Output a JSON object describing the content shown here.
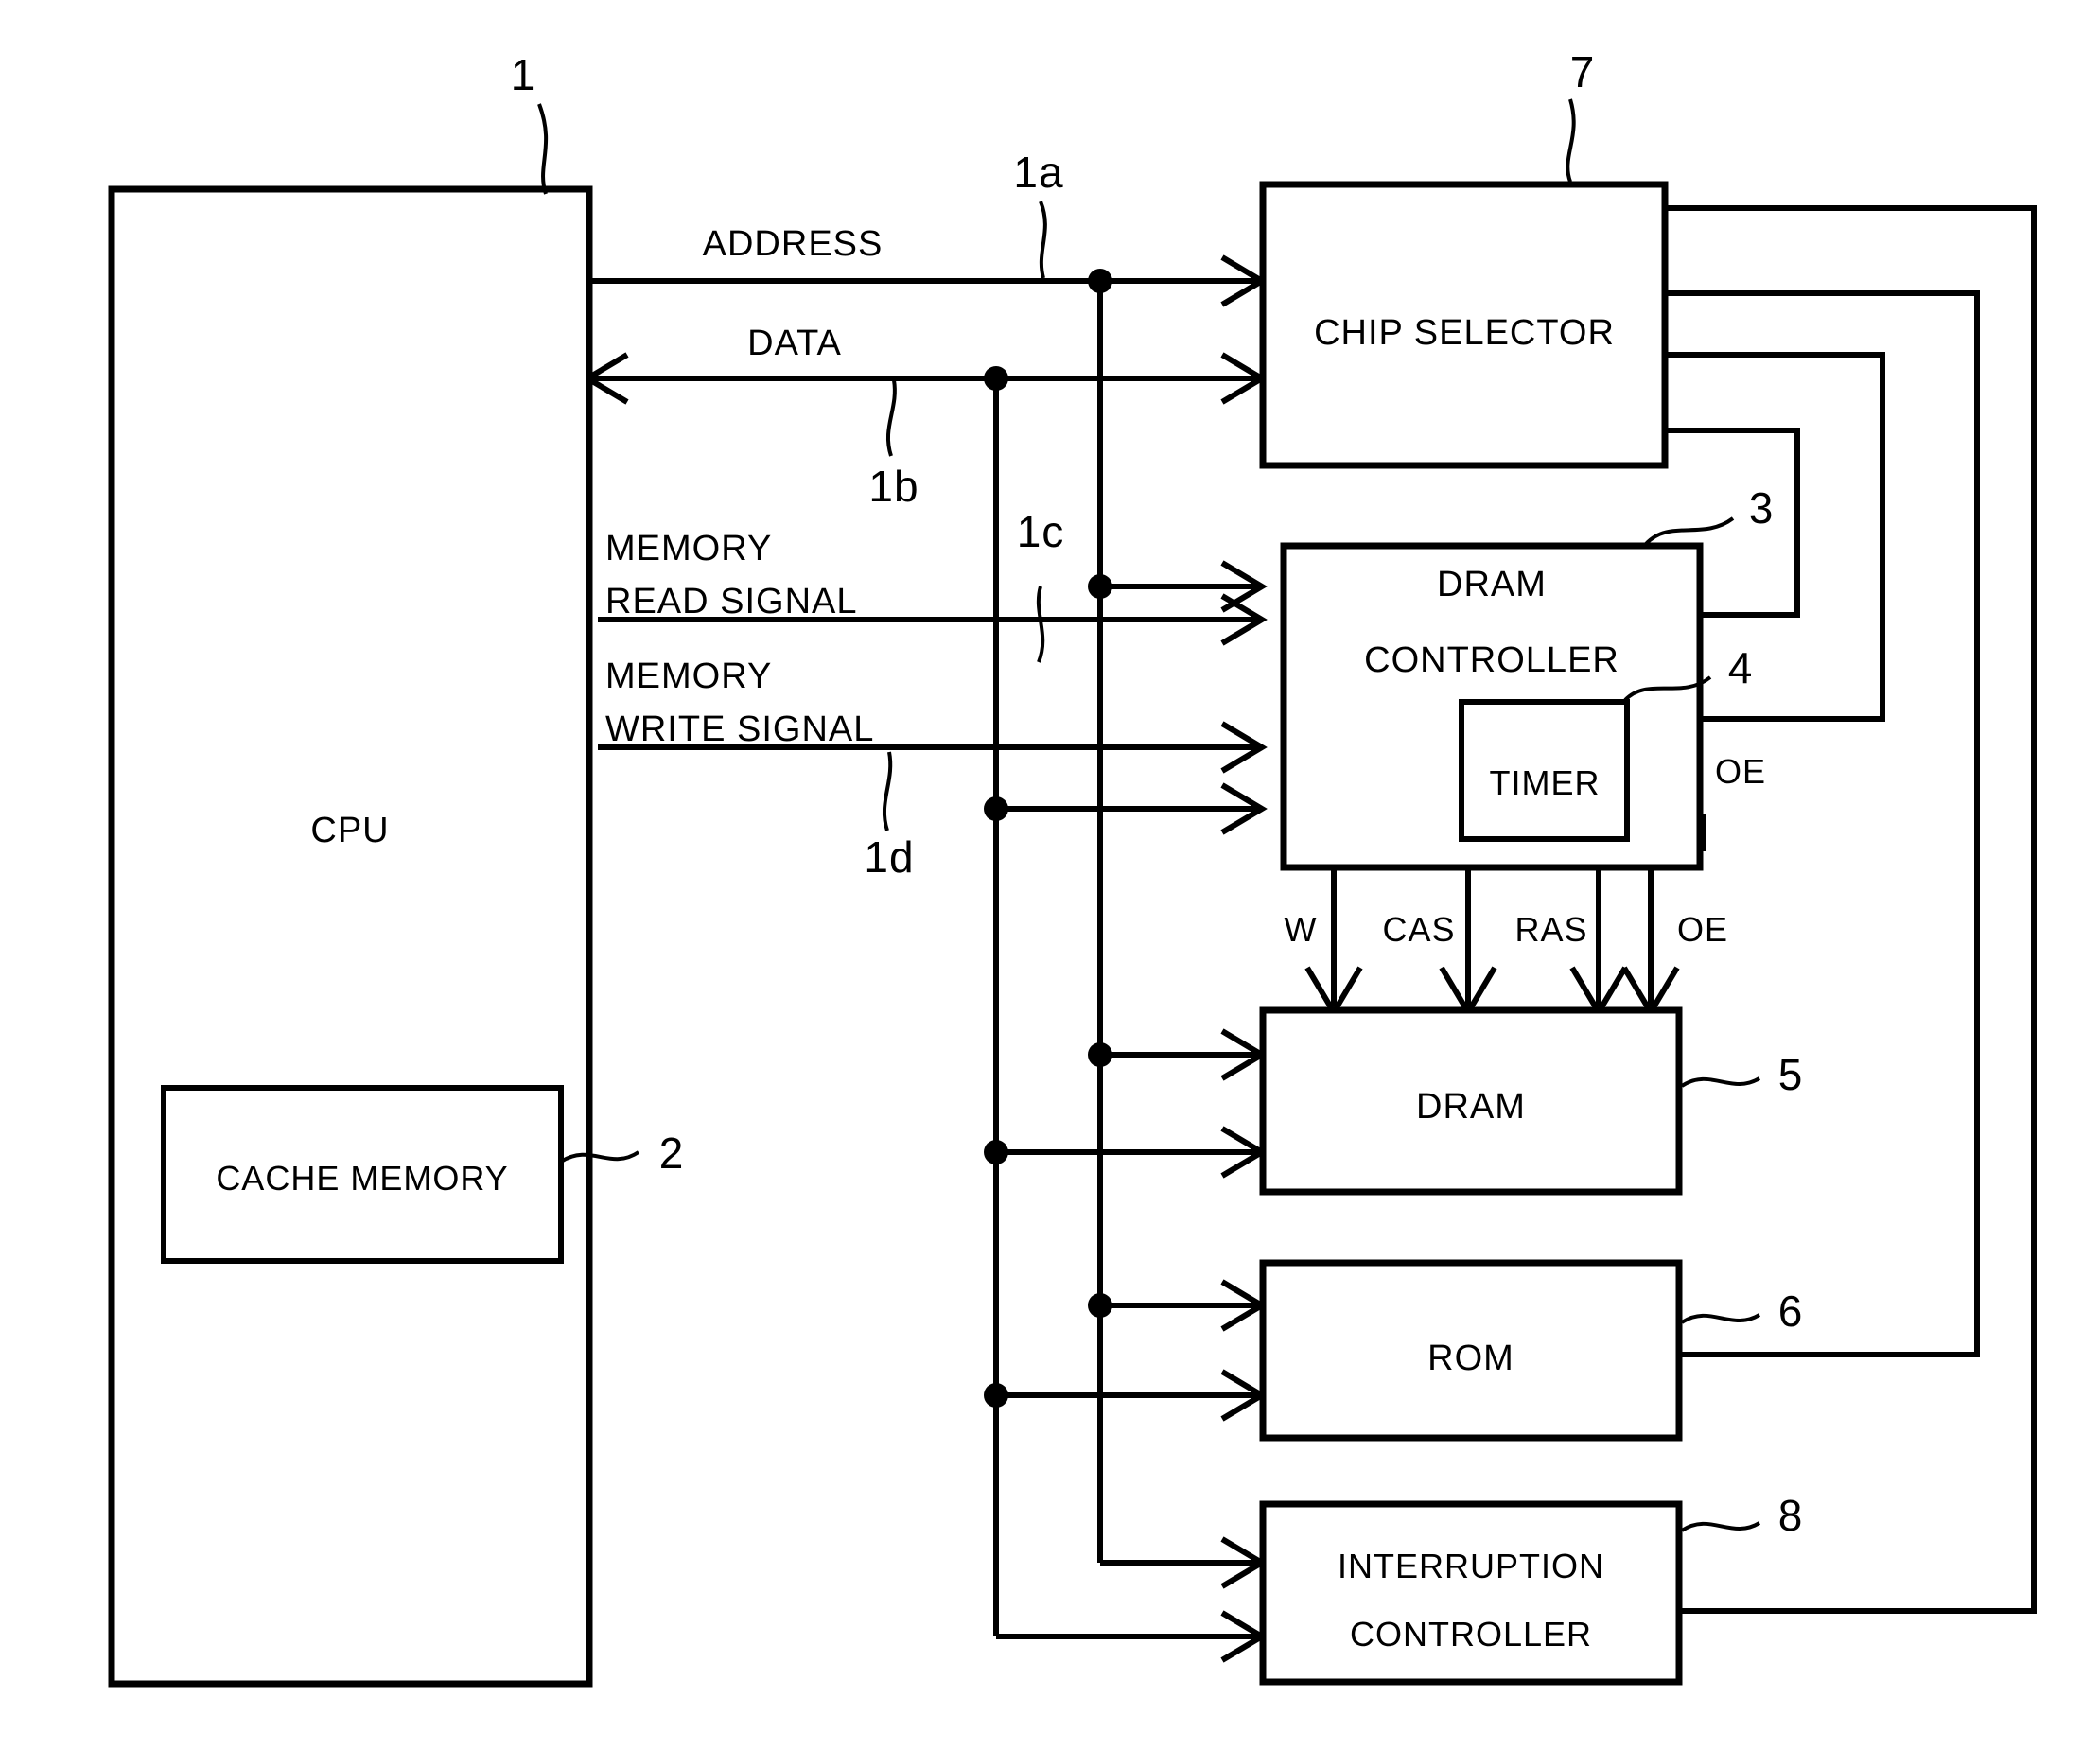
{
  "figure": {
    "type": "block-diagram",
    "background": "#ffffff",
    "line_color": "#000000"
  },
  "blocks": {
    "cpu": {
      "label": "CPU",
      "ref": "1"
    },
    "cache": {
      "label": "CACHE MEMORY",
      "ref": "2"
    },
    "chip_sel": {
      "label": "CHIP SELECTOR",
      "ref": "7"
    },
    "dram_ctrl": {
      "label_line1": "DRAM",
      "label_line2": "CONTROLLER",
      "ref": "3"
    },
    "timer": {
      "label": "TIMER",
      "ref": "4"
    },
    "dram": {
      "label": "DRAM",
      "ref": "5"
    },
    "rom": {
      "label": "ROM",
      "ref": "6"
    },
    "int_ctrl": {
      "label_line1": "INTERRUPTION",
      "label_line2": "CONTROLLER",
      "ref": "8"
    }
  },
  "buses": {
    "address": {
      "label": "ADDRESS",
      "ref": "1a"
    },
    "data": {
      "label": "DATA",
      "ref": "1b"
    },
    "memory_read": {
      "label_line1": "MEMORY",
      "label_line2": "READ SIGNAL",
      "ref": "1c"
    },
    "memory_write": {
      "label_line1": "MEMORY",
      "label_line2": "WRITE SIGNAL",
      "ref": "1d"
    }
  },
  "pins": {
    "w": "W",
    "cas": "CAS",
    "ras": "RAS",
    "oe": "OE",
    "oe_cs": "OE"
  }
}
